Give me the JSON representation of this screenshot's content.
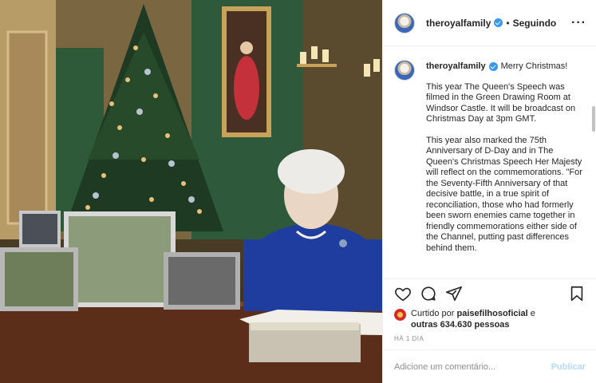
{
  "post": {
    "username": "theroyalfamily",
    "follow_status": "Seguindo",
    "more_icon": "more-dots-icon"
  },
  "caption": {
    "username": "theroyalfamily",
    "greeting": "Merry Christmas!",
    "paragraphs": [
      "This year The Queen's Speech was filmed in the Green Drawing Room at Windsor Castle. It will be broadcast on Christmas Day at 3pm GMT.",
      "This year also marked the 75th Anniversary of D-Day and in The Queen's Christmas Speech Her Majesty will reflect on the commemorations. \"For the Seventy-Fifth Anniversary of that decisive battle, in a true spirit of reconciliation, those who had formerly been sworn enemies came together in friendly commemorations either side of the Channel, putting past differences behind them."
    ]
  },
  "actions": {
    "icons": [
      "heart-icon",
      "comment-icon",
      "share-icon",
      "bookmark-icon"
    ]
  },
  "likes": {
    "prefix": "Curtido por",
    "liker": "paisefilhosoficial",
    "connector": "e",
    "others": "outras 634.630 pessoas"
  },
  "time_ago": "HÁ 1 DIA",
  "comment": {
    "placeholder": "Adicione um comentário...",
    "publish_label": "Publicar"
  },
  "colors": {
    "verified": "#3897f0",
    "publish_disabled": "#b3dbff",
    "border": "#efefef",
    "muted": "#8e8e8e"
  }
}
